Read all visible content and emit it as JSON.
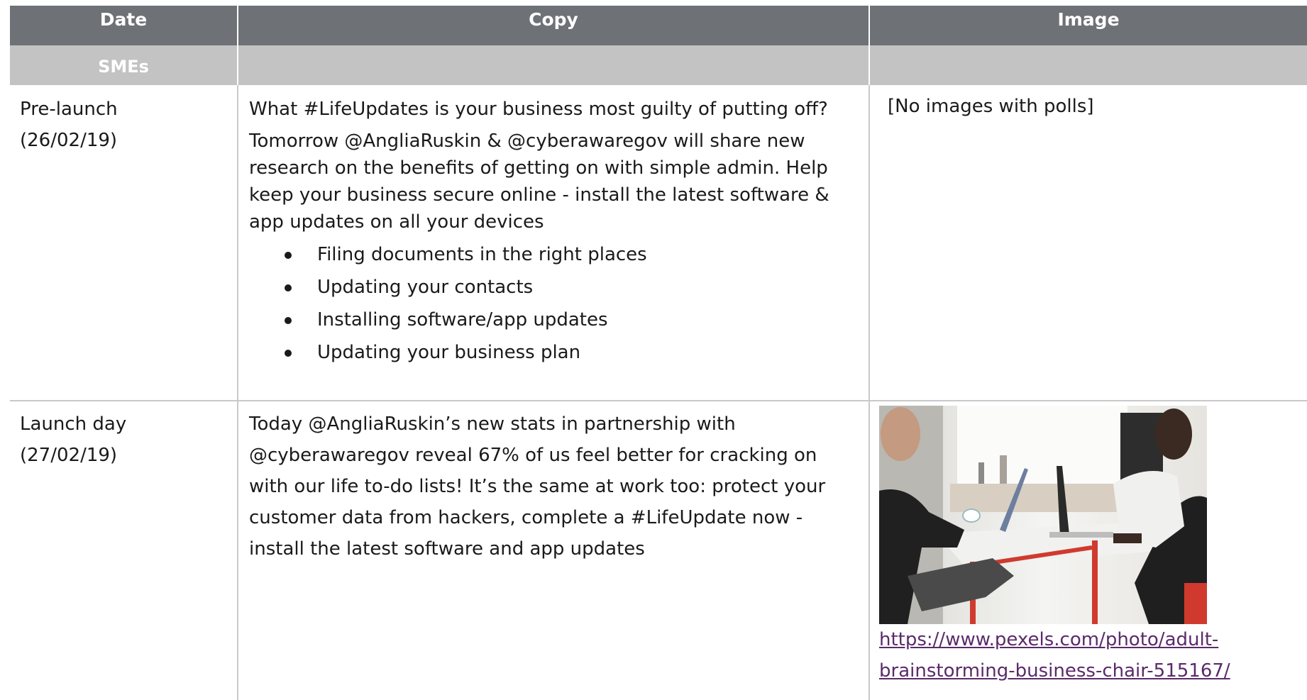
{
  "header": {
    "date": "Date",
    "copy": "Copy",
    "image": "Image"
  },
  "section": {
    "label": "SMEs"
  },
  "rows": [
    {
      "date_lines": [
        "Pre-launch",
        "(26/02/19)"
      ],
      "copy_question": "What #LifeUpdates is your business most guilty of putting off?",
      "copy_lines": [
        "Tomorrow @AngliaRuskin & @cyberawaregov will share new",
        "research on the benefits of getting on with simple admin. Help",
        "keep your business secure online - install the latest software &",
        "app updates on all your devices"
      ],
      "bullets": [
        "Filing documents in the right places",
        "Updating your contacts",
        "Installing software/app updates",
        "Updating your business plan"
      ],
      "image_text": "[No images with polls]"
    },
    {
      "date_lines": [
        "Launch day",
        "(27/02/19)"
      ],
      "copy_lines": [
        "Today @AngliaRuskin’s new stats in partnership with",
        "@cyberawaregov reveal 67% of us feel better for cracking on",
        "with our life to-do lists! It’s the same at work too: protect your",
        "customer data from hackers, complete a #LifeUpdate now -",
        "install the latest software and app updates"
      ],
      "image_link_lines": [
        "https://www.pexels.com/photo/adult-",
        "brainstorming-business-chair-515167/"
      ]
    }
  ]
}
